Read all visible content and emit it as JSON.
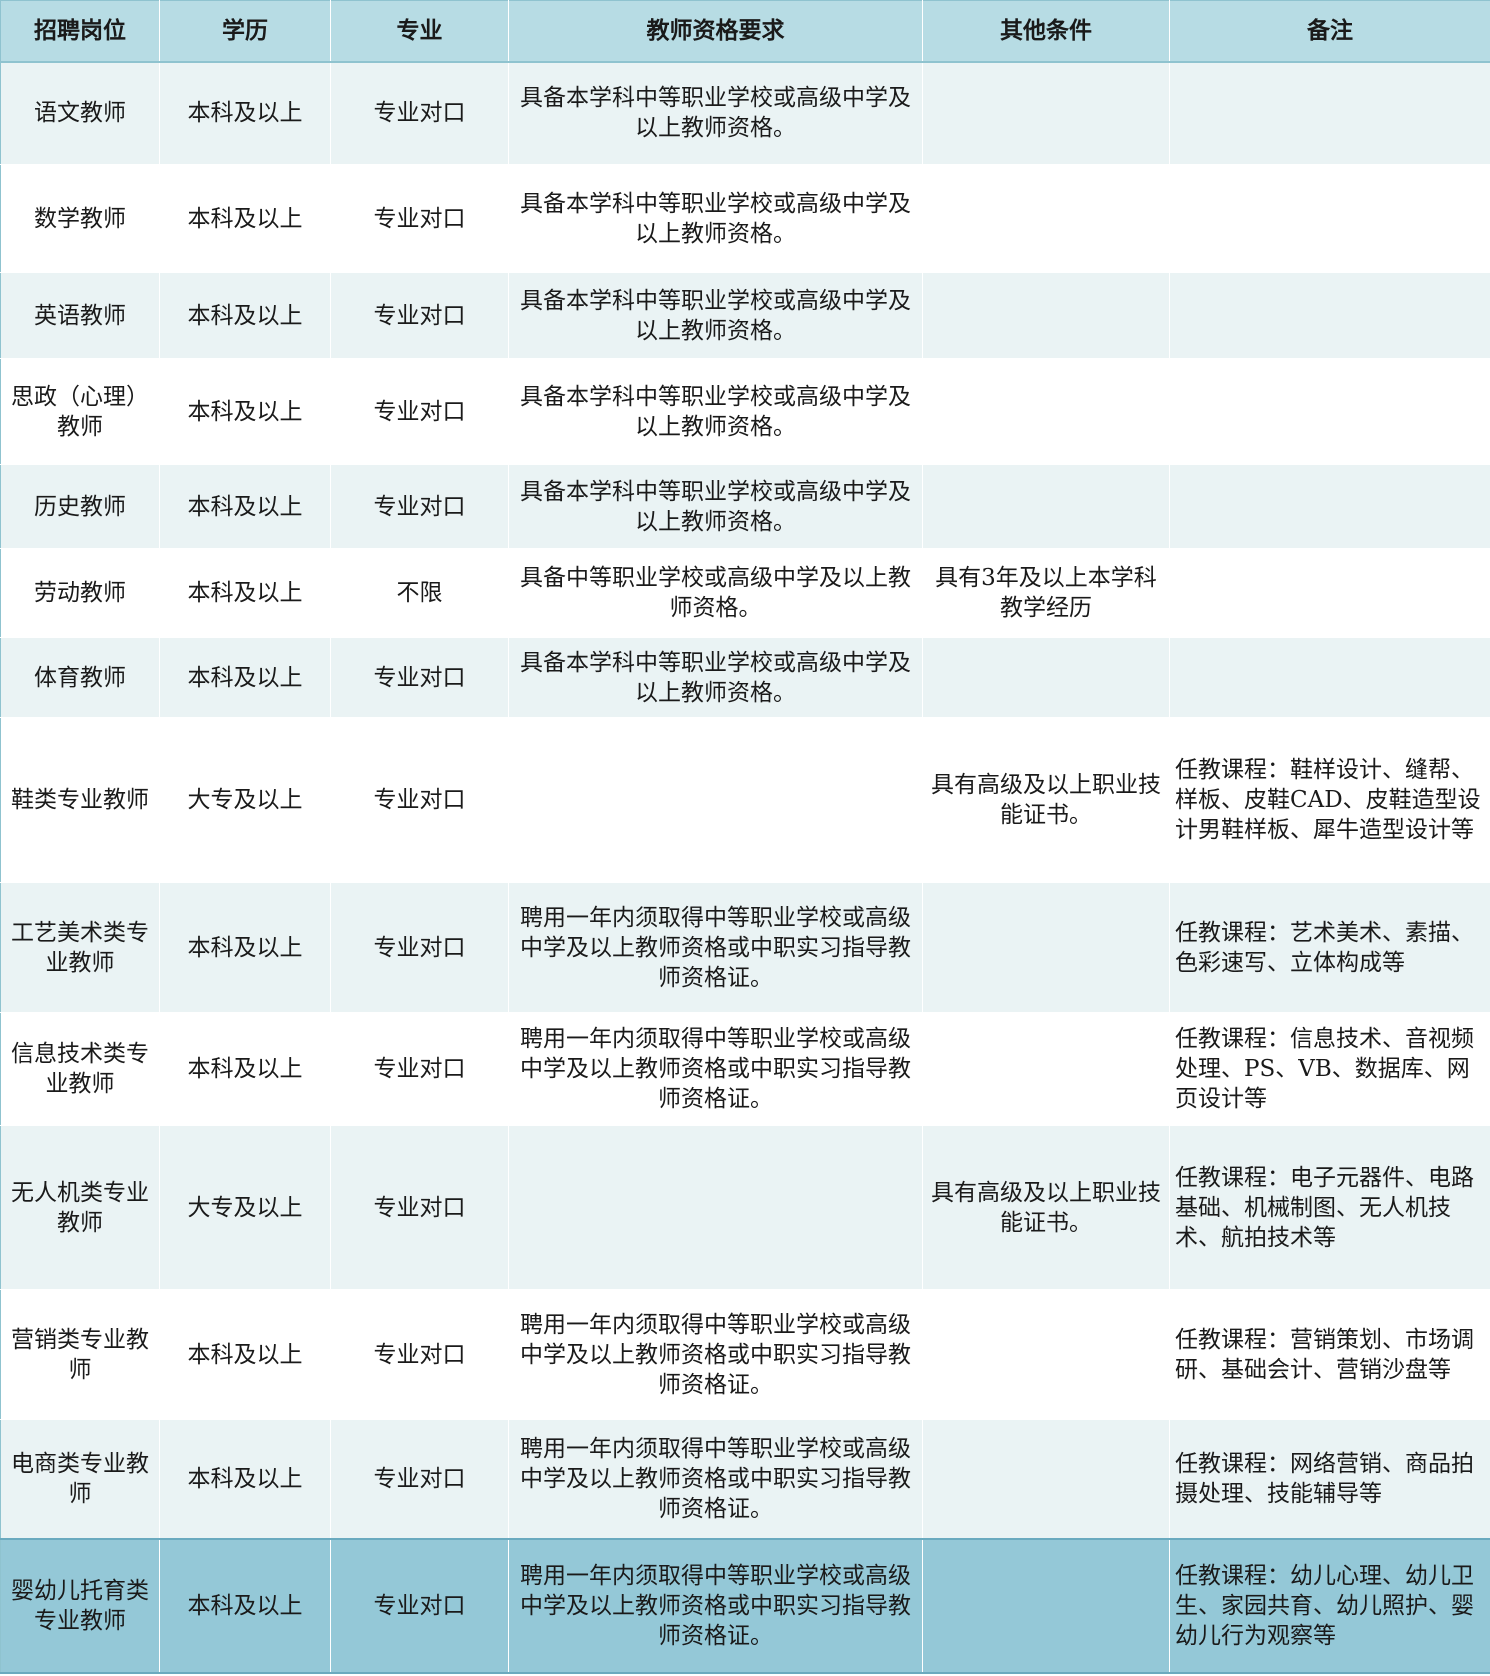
{
  "header": [
    "招聘岗位",
    "学历",
    "专业",
    "教师资格要求",
    "其他条件",
    "备注"
  ],
  "rows": [
    {
      "position": "语文教师",
      "education": "本科及以上",
      "major": "专业对口",
      "qualification": "具备本学科中等职业学校或高级中学及以上教师资格。",
      "other": "",
      "note": ""
    },
    {
      "position": "数学教师",
      "education": "本科及以上",
      "major": "专业对口",
      "qualification": "具备本学科中等职业学校或高级中学及以上教师资格。",
      "other": "",
      "note": ""
    },
    {
      "position": "英语教师",
      "education": "本科及以上",
      "major": "专业对口",
      "qualification": "具备本学科中等职业学校或高级中学及以上教师资格。",
      "other": "",
      "note": ""
    },
    {
      "position": "思政（心理）教师",
      "education": "本科及以上",
      "major": "专业对口",
      "qualification": "具备本学科中等职业学校或高级中学及以上教师资格。",
      "other": "",
      "note": ""
    },
    {
      "position": "历史教师",
      "education": "本科及以上",
      "major": "专业对口",
      "qualification": "具备本学科中等职业学校或高级中学及以上教师资格。",
      "other": "",
      "note": ""
    },
    {
      "position": "劳动教师",
      "education": "本科及以上",
      "major": "不限",
      "qualification": "具备中等职业学校或高级中学及以上教师资格。",
      "other": "具有3年及以上本学科教学经历",
      "note": ""
    },
    {
      "position": "体育教师",
      "education": "本科及以上",
      "major": "专业对口",
      "qualification": "具备本学科中等职业学校或高级中学及以上教师资格。",
      "other": "",
      "note": ""
    },
    {
      "position": "鞋类专业教师",
      "education": "大专及以上",
      "major": "专业对口",
      "qualification": "",
      "other": "具有高级及以上职业技能证书。",
      "note": "任教课程：鞋样设计、缝帮、样板、皮鞋CAD、皮鞋造型设计男鞋样板、犀牛造型设计等"
    },
    {
      "position": "工艺美术类专业教师",
      "education": "本科及以上",
      "major": "专业对口",
      "qualification": "聘用一年内须取得中等职业学校或高级中学及以上教师资格或中职实习指导教师资格证。",
      "other": "",
      "note": "任教课程：艺术美术、素描、色彩速写、立体构成等"
    },
    {
      "position": "信息技术类专业教师",
      "education": "本科及以上",
      "major": "专业对口",
      "qualification": "聘用一年内须取得中等职业学校或高级中学及以上教师资格或中职实习指导教师资格证。",
      "other": "",
      "note": "任教课程：信息技术、音视频处理、PS、VB、数据库、网页设计等"
    },
    {
      "position": "无人机类专业教师",
      "education": "大专及以上",
      "major": "专业对口",
      "qualification": "",
      "other": "具有高级及以上职业技能证书。",
      "note": "任教课程：电子元器件、电路基础、机械制图、无人机技术、航拍技术等"
    },
    {
      "position": "营销类专业教师",
      "education": "本科及以上",
      "major": "专业对口",
      "qualification": "聘用一年内须取得中等职业学校或高级中学及以上教师资格或中职实习指导教师资格证。",
      "other": "",
      "note": "任教课程：营销策划、市场调研、基础会计、营销沙盘等"
    },
    {
      "position": "电商类专业教师",
      "education": "本科及以上",
      "major": "专业对口",
      "qualification": "聘用一年内须取得中等职业学校或高级中学及以上教师资格或中职实习指导教师资格证。",
      "other": "",
      "note": "任教课程：网络营销、商品拍摄处理、技能辅导等"
    },
    {
      "position": "婴幼儿托育类专业教师",
      "education": "本科及以上",
      "major": "专业对口",
      "qualification": "聘用一年内须取得中等职业学校或高级中学及以上教师资格或中职实习指导教师资格证。",
      "other": "",
      "note": "任教课程：幼儿心理、幼儿卫生、家园共育、幼儿照护、婴幼儿行为观察等"
    }
  ]
}
